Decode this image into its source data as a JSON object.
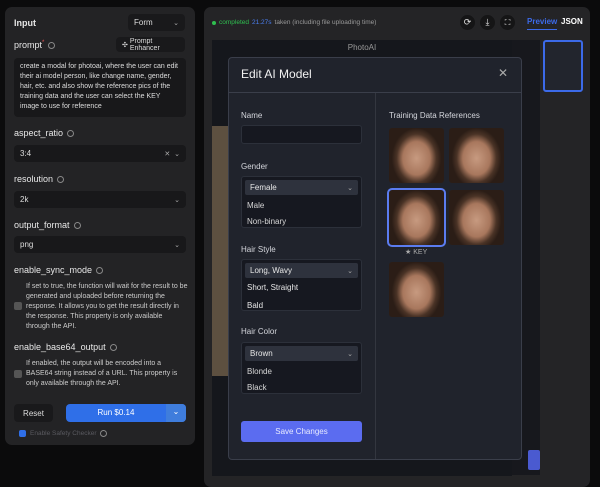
{
  "input_panel": {
    "title": "Input",
    "mode": "Form",
    "prompt_label": "prompt",
    "prompt_required": "*",
    "prompt_enhancer": "Prompt Enhancer",
    "prompt_value": "create a modal for photoai, where the user can edit their ai model person, like change name, gender, hair, etc. and also show the reference pics of the training data and the user can select the KEY image to use for reference",
    "aspect_ratio_label": "aspect_ratio",
    "aspect_ratio_value": "3:4",
    "resolution_label": "resolution",
    "resolution_value": "2k",
    "output_format_label": "output_format",
    "output_format_value": "png",
    "sync_label": "enable_sync_mode",
    "sync_desc": "If set to true, the function will wait for the result to be generated and uploaded before returning the response. It allows you to get the result directly in the response. This property is only available through the API.",
    "base64_label": "enable_base64_output",
    "base64_desc": "If enabled, the output will be encoded into a BASE64 string instead of a URL. This property is only available through the API.",
    "reset": "Reset",
    "run": "Run  $0.14",
    "safety": "Enable Safety Checker"
  },
  "output_panel": {
    "status": "completed",
    "time": "21.27s",
    "time_suffix": "taken (including file uploading time)",
    "tabs": [
      "Preview",
      "JSON"
    ],
    "preview_title": "PhotoAI"
  },
  "modal": {
    "title": "Edit AI Model",
    "name_label": "Name",
    "name_value": "",
    "gender_label": "Gender",
    "gender_options": [
      "Female",
      "Male",
      "Non-binary"
    ],
    "hair_style_label": "Hair Style",
    "hair_style_options": [
      "Long, Wavy",
      "Short, Straight",
      "Bald"
    ],
    "hair_color_label": "Hair Color",
    "hair_color_options": [
      "Brown",
      "Blonde",
      "Black"
    ],
    "save": "Save Changes",
    "refs_label": "Training Data References",
    "key_label": "KEY"
  },
  "colors": {
    "accent": "#2f6fe8",
    "save": "#5b6cf0",
    "status": "#2fbf4f"
  }
}
